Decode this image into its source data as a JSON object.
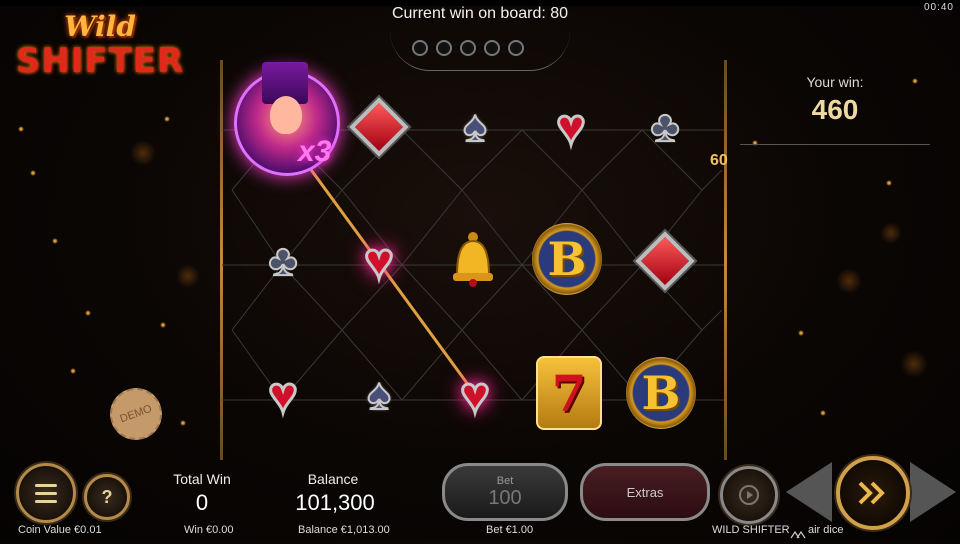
{
  "clock": "00:40",
  "header": {
    "current_win_label": "Current win on board: 80"
  },
  "logo": {
    "line1": "Wild",
    "line2": "SHIFTER"
  },
  "side_panel": {
    "your_win_label": "Your win:",
    "your_win_value": "460",
    "line_payout": "60"
  },
  "board": {
    "multiplier": "x3",
    "rows": [
      [
        "wild-character",
        "diamond",
        "spade",
        "heart",
        "club"
      ],
      [
        "club",
        "heart",
        "bell",
        "bonus-b",
        "diamond"
      ],
      [
        "heart",
        "spade",
        "heart",
        "seven",
        "bonus-b"
      ]
    ],
    "bonus_letter": "B",
    "seven_glyph": "7"
  },
  "demo_stamp": "DEMO",
  "footer": {
    "total_win_label": "Total Win",
    "total_win_value": "0",
    "win_currency": "Win €0.00",
    "balance_label": "Balance",
    "balance_value": "101,300",
    "balance_currency": "Balance €1,013.00",
    "coin_value": "Coin Value €0.01",
    "bet_label": "Bet",
    "bet_value": "100",
    "bet_currency": "Bet €1.00",
    "extras_label": "Extras",
    "game_name": "WILD SHIFTER",
    "provider": "air dice",
    "help_glyph": "?"
  },
  "colors": {
    "accent_gold": "#d0a04a",
    "win_line": "#e0a040",
    "heart_red": "#d0102a"
  }
}
